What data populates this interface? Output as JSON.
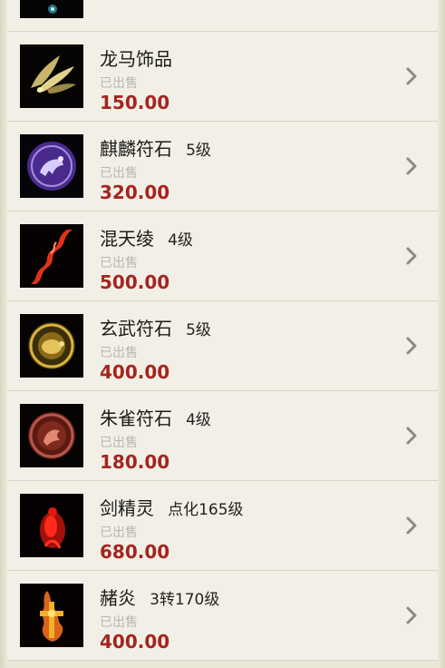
{
  "items": [
    {
      "name": "",
      "level": "",
      "status": "",
      "price": "",
      "icon": "blue-glow-item-icon"
    },
    {
      "name": "龙马饰品",
      "level": "",
      "status": "已出售",
      "price": "150.00",
      "icon": "golden-wings-icon"
    },
    {
      "name": "麒麟符石",
      "level": "5级",
      "status": "已出售",
      "price": "320.00",
      "icon": "qilin-rune-stone-icon"
    },
    {
      "name": "混天绫",
      "level": "4级",
      "status": "已出售",
      "price": "500.00",
      "icon": "red-silk-ribbon-icon"
    },
    {
      "name": "玄武符石",
      "level": "5级",
      "status": "已出售",
      "price": "400.00",
      "icon": "xuanwu-rune-stone-icon"
    },
    {
      "name": "朱雀符石",
      "level": "4级",
      "status": "已出售",
      "price": "180.00",
      "icon": "zhuque-rune-stone-icon"
    },
    {
      "name": "剑精灵",
      "level": "点化165级",
      "status": "已出售",
      "price": "680.00",
      "icon": "red-sword-spirit-icon"
    },
    {
      "name": "赭炎",
      "level": "3转170级",
      "status": "已出售",
      "price": "400.00",
      "icon": "flame-relic-icon"
    }
  ],
  "colors": {
    "price": "#a5251f",
    "status": "#b9b7ad",
    "background": "#f2f0e6"
  }
}
